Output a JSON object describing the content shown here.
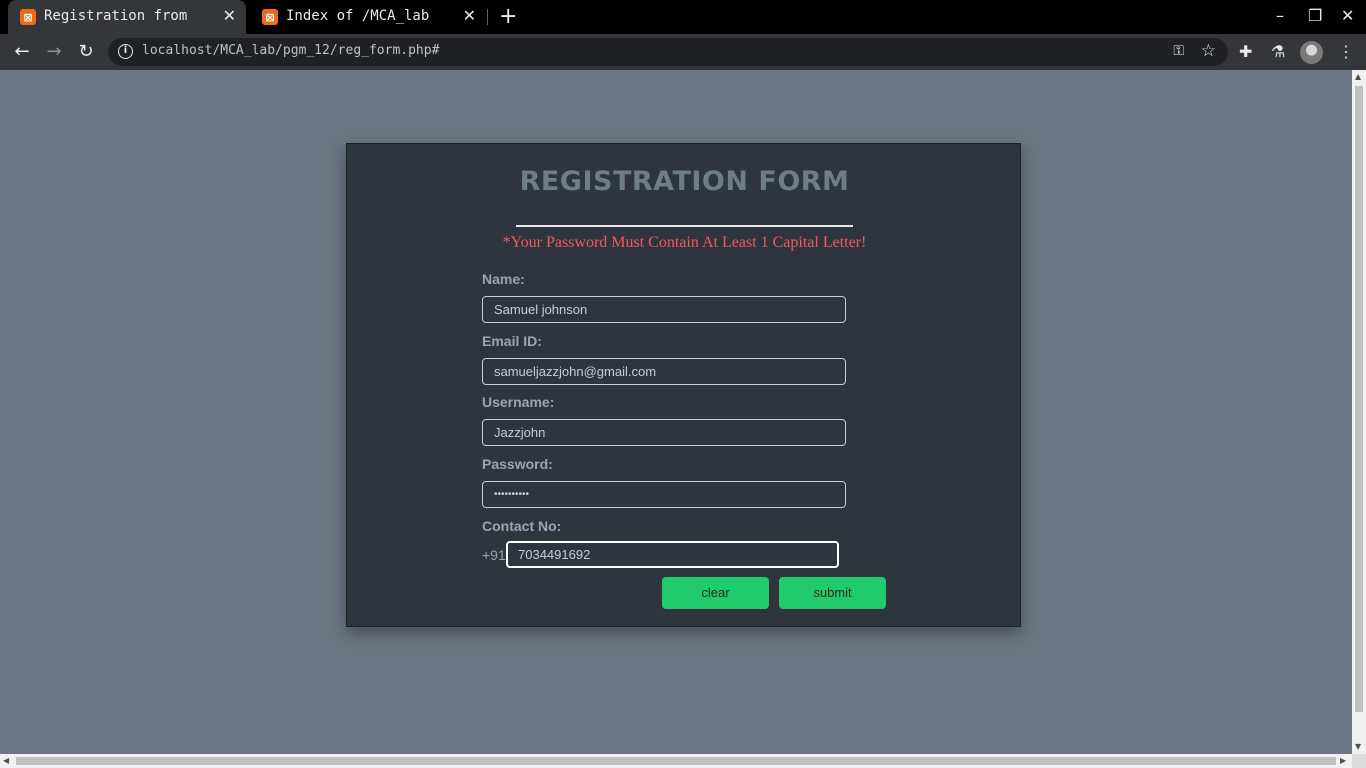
{
  "browser": {
    "tabs": [
      {
        "title": "Registration from",
        "active": true
      },
      {
        "title": "Index of /MCA_lab",
        "active": false
      }
    ],
    "url": "localhost/MCA_lab/pgm_12/reg_form.php#"
  },
  "form": {
    "title": "REGISTRATION FORM",
    "warning": "*Your Password Must Contain At Least 1 Capital Letter!",
    "fields": {
      "name": {
        "label": "Name:",
        "value": "Samuel johnson"
      },
      "email": {
        "label": "Email ID:",
        "value": "samueljazzjohn@gmail.com"
      },
      "username": {
        "label": "Username:",
        "value": "Jazzjohn"
      },
      "password": {
        "label": "Password:",
        "value": "••••••••••"
      },
      "contact": {
        "label": "Contact No:",
        "prefix": "+91",
        "value": "7034491692"
      }
    },
    "buttons": {
      "clear": "clear",
      "submit": "submit"
    }
  },
  "colors": {
    "page_bg": "#6b7583",
    "card_bg": "#2e353e",
    "warning": "#f2595c",
    "button": "#1fcb6b"
  }
}
